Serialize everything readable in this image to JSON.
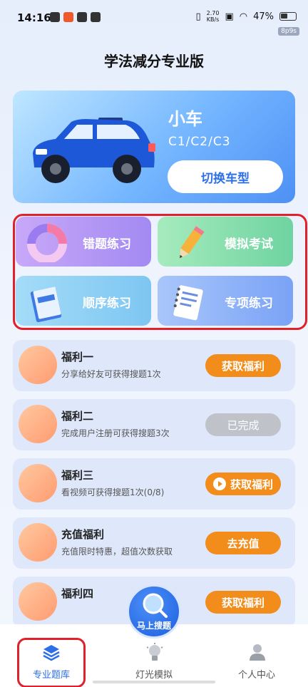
{
  "status_bar": {
    "time": "14:16",
    "speed_value": "2.70",
    "speed_unit": "KB/s",
    "battery": "47%",
    "tag": "8p9s"
  },
  "page_title": "学法减分专业版",
  "car_card": {
    "name": "小车",
    "codes": "C1/C2/C3",
    "switch_label": "切换车型"
  },
  "practice": [
    {
      "label": "错题练习"
    },
    {
      "label": "模拟考试"
    },
    {
      "label": "顺序练习"
    },
    {
      "label": "专项练习"
    }
  ],
  "benefits": [
    {
      "title": "福利一",
      "desc": "分享给好友可获得搜题1次",
      "button": "获取福利",
      "status": "active"
    },
    {
      "title": "福利二",
      "desc": "完成用户注册可获得搜题3次",
      "button": "已完成",
      "status": "done"
    },
    {
      "title": "福利三",
      "desc": "看视频可获得搜题1次(0/8)",
      "button": "获取福利",
      "status": "active"
    },
    {
      "title": "充值福利",
      "desc": "充值限时特惠，超值次数获取",
      "button": "去充值",
      "status": "active"
    },
    {
      "title": "福利四",
      "desc": "",
      "button": "获取福利",
      "status": "active"
    }
  ],
  "fab_label": "马上搜题",
  "nav": [
    {
      "label": "专业题库",
      "active": true
    },
    {
      "label": "灯光模拟",
      "active": false
    },
    {
      "label": "个人中心",
      "active": false
    }
  ],
  "colors": {
    "primary": "#2c6fe6",
    "orange": "#f28c1a",
    "highlight": "#e0202a"
  }
}
